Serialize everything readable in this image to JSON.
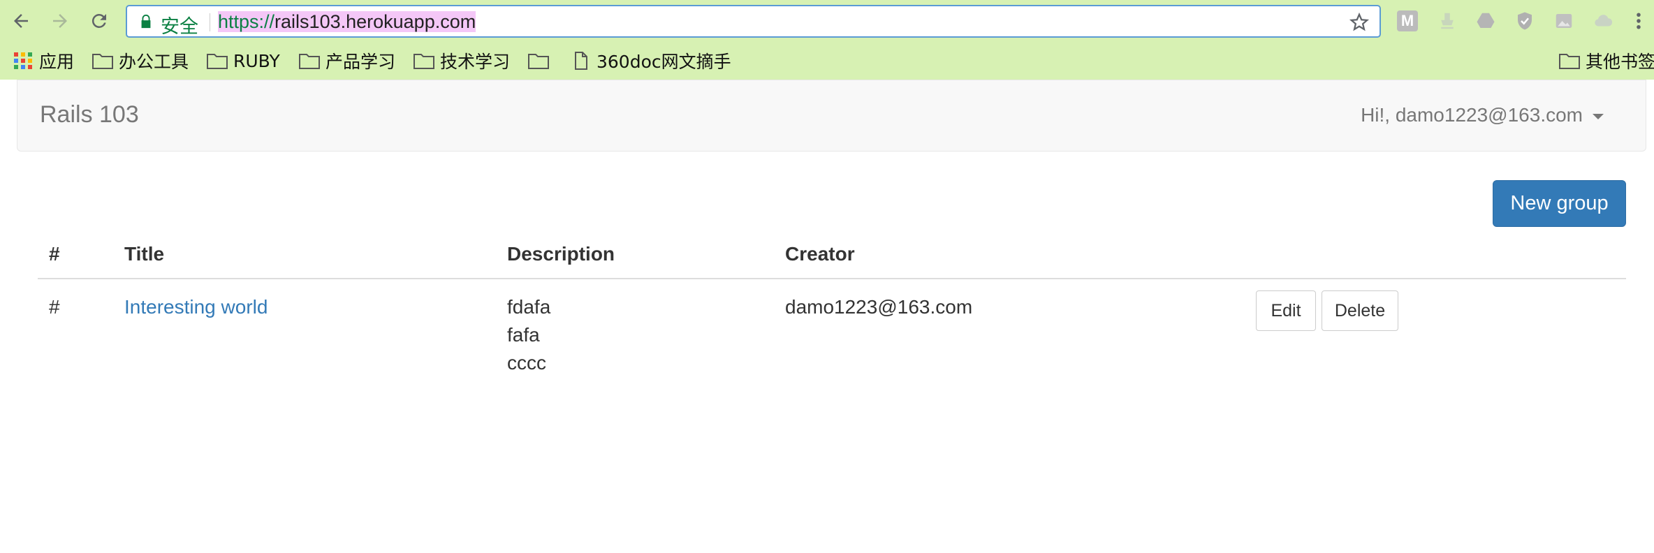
{
  "browser": {
    "secure_label": "安全",
    "url_scheme": "https://",
    "url_host": "rails103.herokuapp.com",
    "extensions": [
      "M"
    ],
    "bookmarks": [
      {
        "label": "应用",
        "icon": "apps-icon"
      },
      {
        "label": "办公工具",
        "icon": "folder-icon"
      },
      {
        "label": "RUBY",
        "icon": "folder-icon"
      },
      {
        "label": "产品学习",
        "icon": "folder-icon"
      },
      {
        "label": "技术学习",
        "icon": "folder-icon"
      },
      {
        "label": "",
        "icon": "folder-icon"
      },
      {
        "label": "360doc网文摘手",
        "icon": "page-icon"
      },
      {
        "label": "其他书签",
        "icon": "folder-icon"
      }
    ]
  },
  "navbar": {
    "brand": "Rails 103",
    "user_greeting": "Hi!, damo1223@163.com"
  },
  "actions": {
    "new_group": "New group"
  },
  "table": {
    "columns": [
      "#",
      "Title",
      "Description",
      "Creator"
    ],
    "rows": [
      {
        "index": "#",
        "title": "Interesting world",
        "description": [
          "fdafa",
          "fafa",
          "cccc"
        ],
        "creator": "damo1223@163.com",
        "edit": "Edit",
        "delete": "Delete"
      }
    ]
  },
  "colors": {
    "chrome": "#d7f1b3",
    "primary": "#337ab7",
    "secure": "#0b8043"
  }
}
